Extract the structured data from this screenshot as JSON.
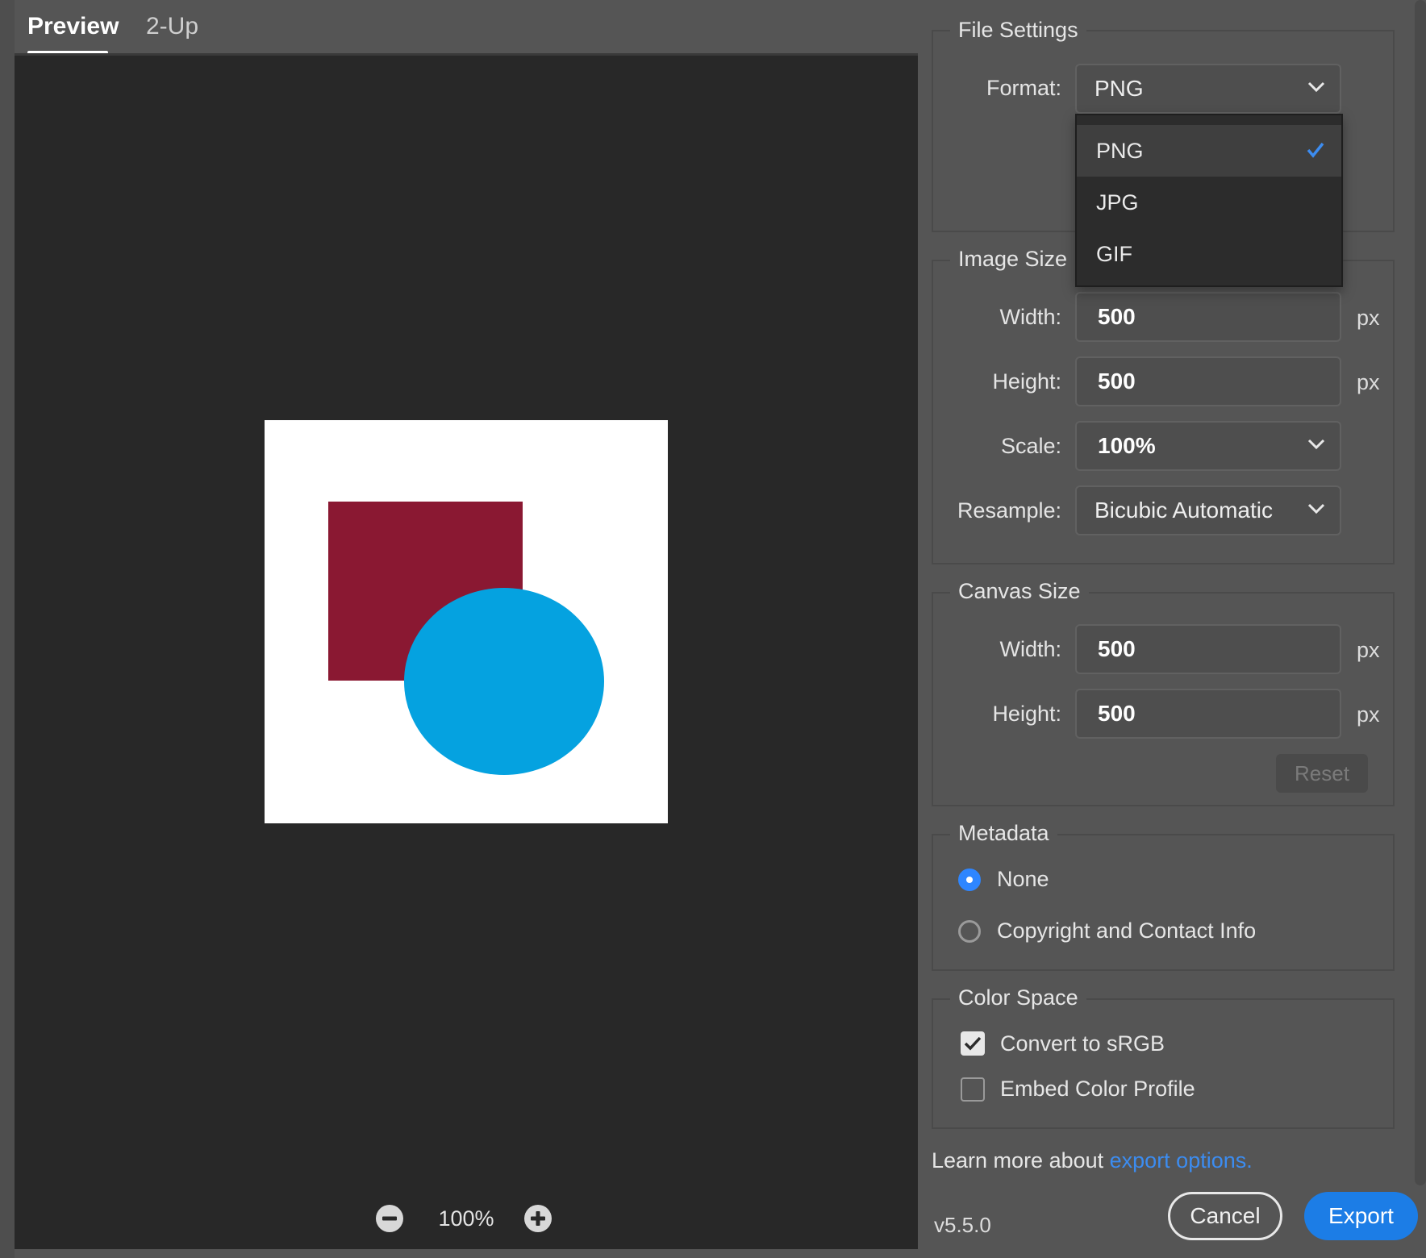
{
  "tabs": {
    "preview": "Preview",
    "two_up": "2-Up"
  },
  "zoom": {
    "level": "100%"
  },
  "preview": {
    "colors": {
      "square": "#8a1832",
      "circle": "#05a2e0",
      "background": "#ffffff"
    }
  },
  "file_settings": {
    "legend": "File Settings",
    "format_label": "Format:",
    "format_value": "PNG",
    "format_options": [
      "PNG",
      "JPG",
      "GIF"
    ]
  },
  "image_size": {
    "legend": "Image Size",
    "width_label": "Width:",
    "width_value": "500",
    "height_label": "Height:",
    "height_value": "500",
    "scale_label": "Scale:",
    "scale_value": "100%",
    "resample_label": "Resample:",
    "resample_value": "Bicubic Automatic",
    "unit": "px"
  },
  "canvas_size": {
    "legend": "Canvas Size",
    "width_label": "Width:",
    "width_value": "500",
    "height_label": "Height:",
    "height_value": "500",
    "unit": "px",
    "reset_label": "Reset"
  },
  "metadata": {
    "legend": "Metadata",
    "options": [
      "None",
      "Copyright and Contact Info"
    ],
    "selected": "None"
  },
  "color_space": {
    "legend": "Color Space",
    "convert_label": "Convert to sRGB",
    "convert_checked": true,
    "embed_label": "Embed Color Profile",
    "embed_checked": false
  },
  "footer": {
    "learn_prefix": "Learn more about ",
    "learn_link": "export options.",
    "version": "v5.5.0",
    "cancel_label": "Cancel",
    "export_label": "Export"
  }
}
